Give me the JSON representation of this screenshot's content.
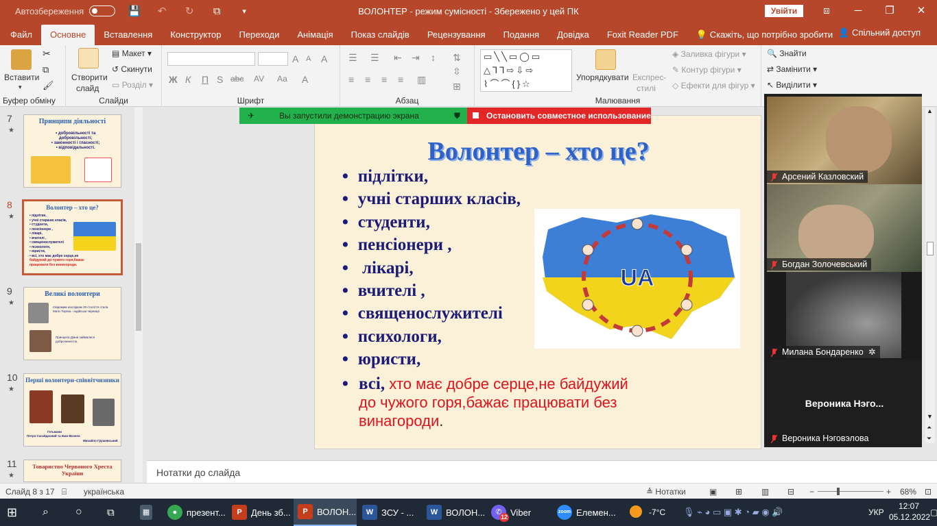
{
  "titlebar": {
    "autosave": "Автозбереження",
    "title": "ВОЛОНТЕР  -  режим сумісності  -  Збережено у цей ПК",
    "signin": "Увійти"
  },
  "menu": {
    "tabs": [
      "Файл",
      "Основне",
      "Вставлення",
      "Конструктор",
      "Переходи",
      "Анімація",
      "Показ слайдів",
      "Рецензування",
      "Подання",
      "Довідка",
      "Foxit Reader PDF",
      "Скажіть, що потрібно зробити"
    ],
    "share": "Спільний доступ"
  },
  "ribbon": {
    "paste": "Вставити",
    "clipboard_group": "Буфер обміну",
    "new_slide_1": "Створити",
    "new_slide_2": "слайд",
    "layout": "Макет",
    "reset": "Скинути",
    "section": "Розділ",
    "slides_group": "Слайди",
    "font_group": "Шрифт",
    "font_buttons": [
      "Ж",
      "К",
      "П",
      "S",
      "abc",
      "AV",
      "Аа"
    ],
    "paragraph_group": "Абзац",
    "arrange_1": "Упорядкувати",
    "styles_1": "Експрес-",
    "styles_2": "стилі",
    "fill": "Заливка фігури",
    "outline": "Контур фігури",
    "effects": "Ефекти для фігур",
    "drawing_group": "Малювання",
    "find": "Знайти",
    "replace": "Замінити",
    "select": "Виділити",
    "shapes_glyphs": "▭╲╲▭◯▭ △⅂⅂⇨⇩⇨ ⌇⌒⌒{}☆"
  },
  "thumbnails": [
    {
      "num": "7",
      "title": "Принципи діяльності",
      "lines": [
        "• добровільності та",
        "добровільності;",
        "• законності і гласності;",
        "• відповідальності."
      ]
    },
    {
      "num": "8",
      "title": "Волонтер – хто це?",
      "lines": [
        "• підлітки,",
        "• учні старших класів,",
        "• студенти,",
        "• пенсіонери ,",
        "• лікарі,",
        "• вчителі ,",
        "• священослужителі",
        "• психологи,",
        "• юристи,",
        "• всі, хто має добре серце,не",
        "байдужий до чужого горя,бажає",
        "працювати без винагороди."
      ]
    },
    {
      "num": "9",
      "title": "Великі волонтери",
      "lines": [
        "Свідомим наслідкам 20 століття стала",
        "Мати Тереза - індійська черниця",
        "Принцеса Діана займалася",
        "доброчинністю."
      ]
    },
    {
      "num": "10",
      "title": "Перші волонтери-співвітчизники",
      "lines": [
        "Гетьмани",
        "Петро Сагайдачний та Іван Мазепа",
        "Михайло Грушевський"
      ]
    },
    {
      "num": "11",
      "title": "Товариство Червоного Хреста України",
      "lines": []
    }
  ],
  "share_bar": {
    "green": "Вы запустили демонстрацию экрана",
    "red": "Остановить совместное использование"
  },
  "slide": {
    "title": "Волонтер – хто це?",
    "items": [
      "підлітки,",
      "учні старших класів,",
      "студенти,",
      "пенсіонери ,",
      " лікарі,",
      "вчителі ,",
      "священослужителі",
      "психологи,",
      "юристи,"
    ],
    "last_bold": "всі,",
    "last_red": " хто має добре серце,не байдужий  до чужого горя,бажає працювати без винагороди",
    "last_dot": ".",
    "map_label": "UA"
  },
  "video": {
    "participants": [
      {
        "name": "Арсений Казловский"
      },
      {
        "name": "Богдан Золочевський"
      },
      {
        "name": "Милана Бондаренко"
      },
      {
        "name": "Вероника  Нэго...",
        "label": "Вероника Нэговэлова"
      }
    ]
  },
  "notes": {
    "placeholder": "Нотатки до слайда"
  },
  "status": {
    "slide": "Слайд 8 з 17",
    "language": "українська",
    "notes": "Нотатки",
    "zoom": "68%"
  },
  "taskbar": {
    "apps": [
      {
        "label": "презент...",
        "color": "#f2c230"
      },
      {
        "label": "День зб...",
        "color": "#c43e1c"
      },
      {
        "label": "ВОЛОН...",
        "color": "#c43e1c"
      },
      {
        "label": "ЗСУ - ...",
        "color": "#2b579a"
      },
      {
        "label": "ВОЛОН...",
        "color": "#2b579a"
      },
      {
        "label": "Viber",
        "color": "#7360f2"
      },
      {
        "label": "Елемен...",
        "color": "#2d8cff"
      }
    ],
    "viber_badge": "12",
    "weather": "-7°C",
    "lang": "УКР",
    "time": "12:07",
    "date": "05.12.2022"
  },
  "colors": {
    "accent": "#b7472a",
    "slide_title": "#2e62c8",
    "bullet_text": "#1c1c78",
    "red_text": "#e0131d",
    "share_green": "#22b14c",
    "share_red": "#e32626"
  }
}
